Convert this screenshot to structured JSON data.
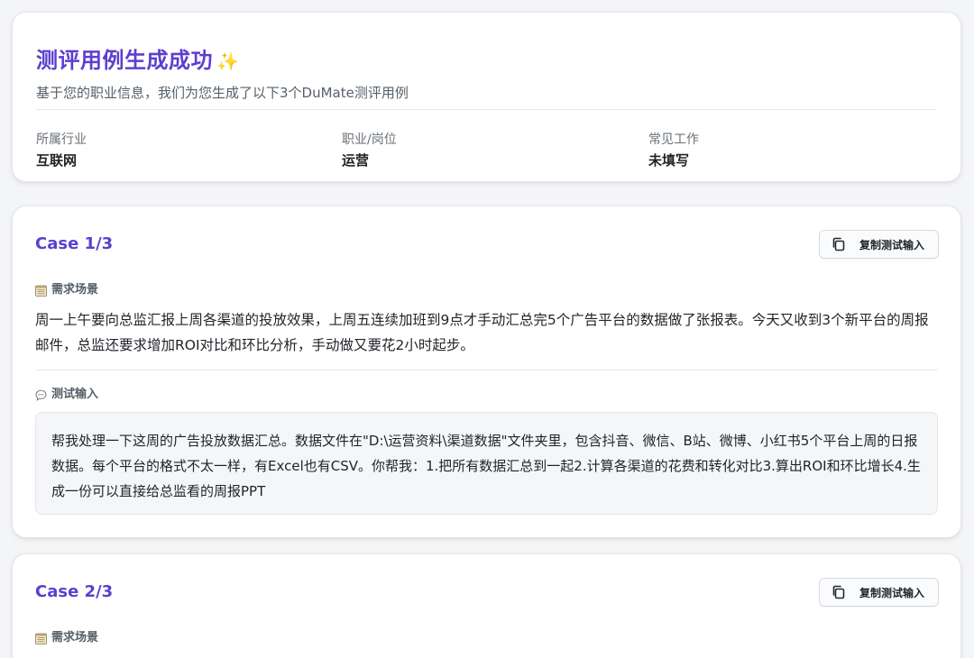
{
  "summary": {
    "title": "测评用例生成成功",
    "title_emoji": "✨",
    "subtitle": "基于您的职业信息，我们为您生成了以下3个DuMate测评用例",
    "fields": [
      {
        "label": "所属行业",
        "value": "互联网"
      },
      {
        "label": "职业/岗位",
        "value": "运营"
      },
      {
        "label": "常见工作",
        "value": "未填写"
      }
    ]
  },
  "cases": [
    {
      "title": "Case 1/3",
      "copy_label": "复制测试输入",
      "scene_label": "需求场景",
      "scene_text": "周一上午要向总监汇报上周各渠道的投放效果，上周五连续加班到9点才手动汇总完5个广告平台的数据做了张报表。今天又收到3个新平台的周报邮件，总监还要求增加ROI对比和环比分析，手动做又要花2小时起步。",
      "input_label": "测试输入",
      "input_text": "帮我处理一下这周的广告投放数据汇总。数据文件在\"D:\\运营资料\\渠道数据\"文件夹里，包含抖音、微信、B站、微博、小红书5个平台上周的日报数据。每个平台的格式不太一样，有Excel也有CSV。你帮我：1.把所有数据汇总到一起2.计算各渠道的花费和转化对比3.算出ROI和环比增长4.生成一份可以直接给总监看的周报PPT"
    },
    {
      "title": "Case 2/3",
      "copy_label": "复制测试输入",
      "scene_label": "需求场景"
    }
  ],
  "icons": {
    "copy": "copy-icon",
    "scene": "notepad-icon",
    "input": "speech-bubble-icon"
  },
  "colors": {
    "accent": "#5b3fd0",
    "background": "#f4f5f7"
  }
}
